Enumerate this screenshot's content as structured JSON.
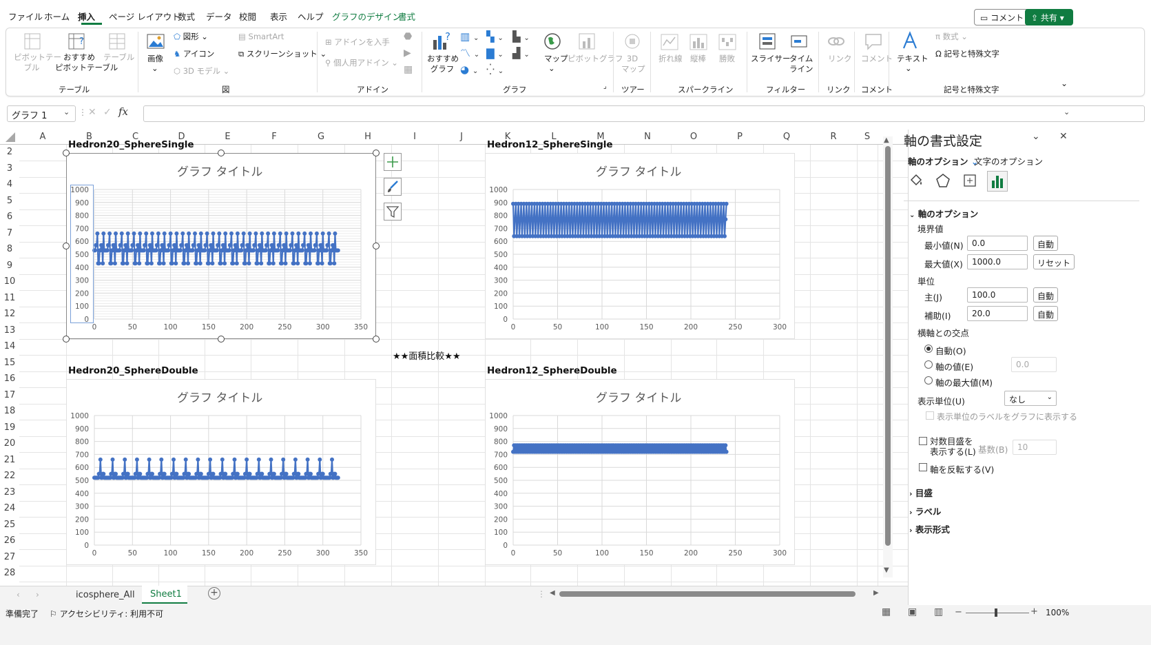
{
  "menu": [
    "ファイル",
    "ホーム",
    "挿入",
    "ページ レイアウト",
    "数式",
    "データ",
    "校閲",
    "表示",
    "ヘルプ",
    "グラフのデザイン",
    "書式"
  ],
  "topbar": {
    "comment": "コメント",
    "share": "共有"
  },
  "ribbon": {
    "pivot": "ピボットテー\nブル",
    "rec_pivot": "おすすめ\nピボットテーブル",
    "table": "テーブル",
    "group_table": "テーブル",
    "image": "画像",
    "shapes": "図形",
    "icons": "アイコン",
    "model3d": "3D モデル",
    "smartart": "SmartArt",
    "screenshot": "スクリーンショット",
    "group_zu": "図",
    "get_addin": "アドインを入手",
    "my_addin": "個人用アドイン",
    "group_addin": "アドイン",
    "rec_chart": "おすすめ\nグラフ",
    "map": "マップ",
    "pivot_chart": "ピボットグラフ",
    "group_graph": "グラフ",
    "map3d": "3D\nマップ",
    "group_tour": "ツアー",
    "spark_line": "折れ線",
    "spark_col": "縦棒",
    "spark_wl": "勝敗",
    "group_spark": "スパークライン",
    "slicer": "スライサー",
    "timeline": "タイム\nライン",
    "group_filter": "フィルター",
    "link": "リンク",
    "group_link": "リンク",
    "comment": "コメント",
    "group_comment": "コメント",
    "text": "テキスト",
    "equation": "数式",
    "symbol": "記号と特殊文字",
    "group_symbol": "記号と特殊文字"
  },
  "formula": {
    "namebox": "グラフ 1",
    "value": ""
  },
  "columns": [
    "A",
    "B",
    "C",
    "D",
    "E",
    "F",
    "G",
    "H",
    "I",
    "J",
    "K",
    "L",
    "M",
    "N",
    "O",
    "P",
    "Q",
    "R",
    "S"
  ],
  "rows": [
    "2",
    "3",
    "4",
    "5",
    "6",
    "7",
    "8",
    "9",
    "10",
    "11",
    "12",
    "13",
    "14",
    "15",
    "16",
    "17",
    "18",
    "19",
    "20",
    "21",
    "22",
    "23",
    "24",
    "25",
    "26",
    "27",
    "28"
  ],
  "cells": {
    "center_label": "★★面積比較★★"
  },
  "charts": [
    {
      "label": "Hedron20_SphereSingle",
      "title": "グラフ タイトル"
    },
    {
      "label": "Hedron12_SphereSingle",
      "title": "グラフ タイトル"
    },
    {
      "label": "Hedron20_SphereDouble",
      "title": "グラフ タイトル"
    },
    {
      "label": "Hedron12_SphereDouble",
      "title": "グラフ タイトル"
    }
  ],
  "chart_data": [
    {
      "type": "line",
      "title": "グラフ タイトル",
      "ylim": [
        0,
        1000
      ],
      "xlim": [
        0,
        350
      ],
      "yticks": [
        0,
        100,
        200,
        300,
        400,
        500,
        600,
        700,
        800,
        900,
        1000
      ],
      "xticks": [
        0,
        50,
        100,
        150,
        200,
        250,
        300,
        350
      ],
      "pattern": "hedron20_single",
      "x_end": 320,
      "levels": [
        430,
        530,
        570,
        660
      ],
      "period": 16,
      "grid_minor": true
    },
    {
      "type": "line",
      "title": "グラフ タイトル",
      "ylim": [
        0,
        1000
      ],
      "xlim": [
        0,
        300
      ],
      "yticks": [
        0,
        100,
        200,
        300,
        400,
        500,
        600,
        700,
        800,
        900,
        1000
      ],
      "xticks": [
        0,
        50,
        100,
        150,
        200,
        250,
        300
      ],
      "pattern": "hedron12_single",
      "x_end": 240,
      "levels": [
        640,
        770,
        890
      ],
      "period": 2.5,
      "grid_minor": false
    },
    {
      "type": "line",
      "title": "グラフ タイトル",
      "ylim": [
        0,
        1000
      ],
      "xlim": [
        0,
        350
      ],
      "yticks": [
        0,
        100,
        200,
        300,
        400,
        500,
        600,
        700,
        800,
        900,
        1000
      ],
      "xticks": [
        0,
        50,
        100,
        150,
        200,
        250,
        300,
        350
      ],
      "pattern": "hedron20_double",
      "x_end": 320,
      "levels": [
        520,
        550,
        660
      ],
      "period": 16,
      "grid_minor": false
    },
    {
      "type": "line",
      "title": "グラフ タイトル",
      "ylim": [
        0,
        1000
      ],
      "xlim": [
        0,
        300
      ],
      "yticks": [
        0,
        100,
        200,
        300,
        400,
        500,
        600,
        700,
        800,
        900,
        1000
      ],
      "xticks": [
        0,
        50,
        100,
        150,
        200,
        250,
        300
      ],
      "pattern": "hedron12_double",
      "x_end": 240,
      "levels": [
        720,
        770
      ],
      "period": 2.5,
      "grid_minor": false
    }
  ],
  "sheet_tabs": [
    "icosphere_All",
    "Sheet1"
  ],
  "status": {
    "ready": "準備完了",
    "accessibility": "アクセシビリティ: 利用不可",
    "zoom": "100%"
  },
  "pane": {
    "title": "軸の書式設定",
    "tab_axis": "軸のオプション",
    "tab_text": "文字のオプション",
    "section_axis": "軸のオプション",
    "bounds": "境界値",
    "min_label": "最小値(N)",
    "min_value": "0.0",
    "min_btn": "自動",
    "max_label": "最大値(X)",
    "max_value": "1000.0",
    "max_btn": "リセット",
    "units": "単位",
    "major_label": "主(J)",
    "major_value": "100.0",
    "major_btn": "自動",
    "minor_label": "補助(I)",
    "minor_value": "20.0",
    "minor_btn": "自動",
    "cross": "横軸との交点",
    "cross_auto": "自動(O)",
    "cross_value": "軸の値(E)",
    "cross_value_val": "0.0",
    "cross_max": "軸の最大値(M)",
    "display_units": "表示単位(U)",
    "display_units_value": "なし",
    "show_units_label": "表示単位のラベルをグラフに表示する",
    "log_scale": "対数目盛を\n表示する(L)",
    "base_label": "基数(B)",
    "base_value": "10",
    "reverse": "軸を反転する(V)",
    "sec_ticks": "目盛",
    "sec_labels": "ラベル",
    "sec_format": "表示形式"
  }
}
